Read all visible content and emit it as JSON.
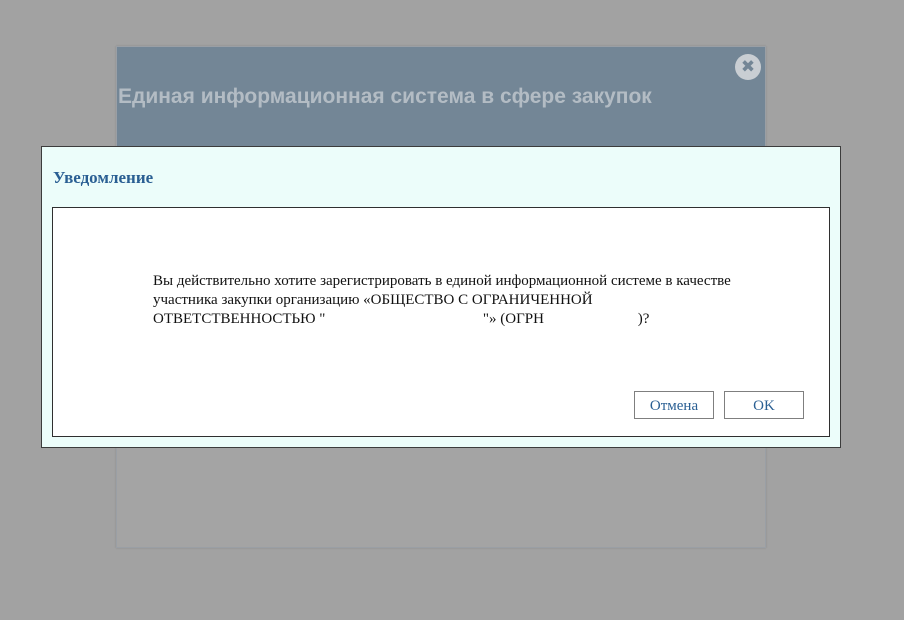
{
  "background_modal": {
    "title": "Единая информационная система в сфере закупок",
    "close_glyph": "✖"
  },
  "dialog": {
    "title": "Уведомление",
    "message_lines": [
      "Вы действительно хотите зарегистрировать в единой информационной системе в качестве",
      "участника закупки организацию «ОБЩЕСТВО С ОГРАНИЧЕННОЙ",
      "ОТВЕТСТВЕННОСТЬЮ \"                                          \"» (ОГРН                         )?"
    ],
    "buttons": {
      "cancel_label": "Отмена",
      "ok_label": "OK"
    }
  },
  "colors": {
    "overlay": "#a2a2a2",
    "header_bg": "#738696",
    "dialog_bg": "#ecfdfa",
    "accent_text": "#2a5f93"
  }
}
